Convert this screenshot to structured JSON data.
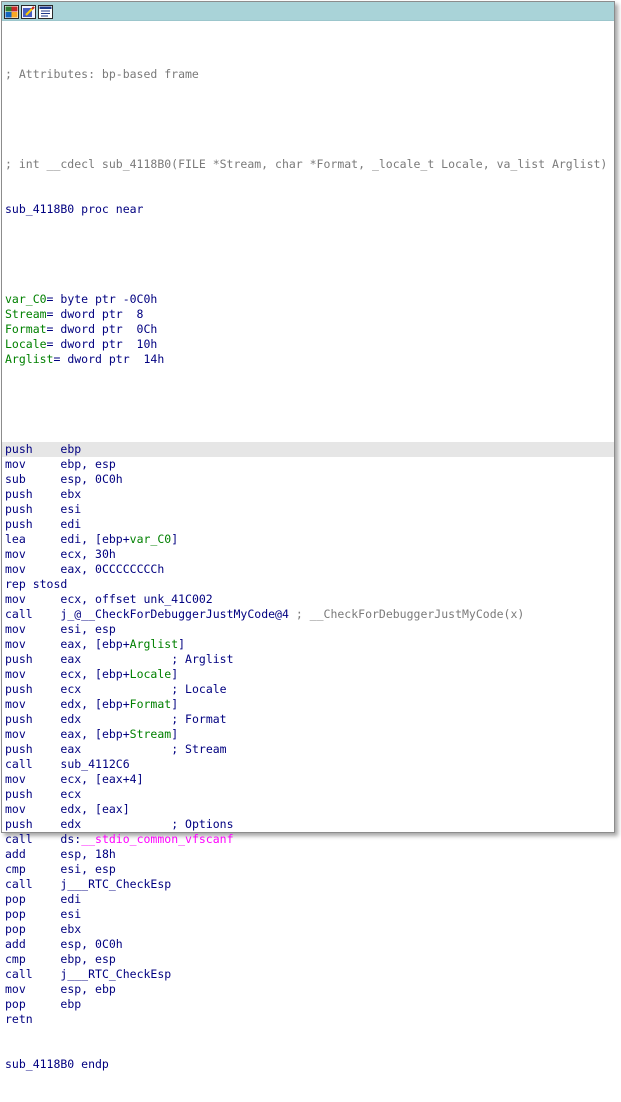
{
  "toolbar": {
    "icons": [
      "graph-view-icon",
      "edit-icon",
      "text-view-icon"
    ]
  },
  "colors": {
    "toolbar_bg": "#a9d3d8",
    "code_blue": "#000080",
    "comment_gray": "#7a7a7a",
    "var_green": "#008000",
    "import_magenta": "#ff00ff",
    "highlight": "#e6e6e6"
  },
  "listing": {
    "attributes_comment": "; Attributes: bp-based frame",
    "signature_comment": "; int __cdecl sub_4118B0(FILE *Stream, char *Format, _locale_t Locale, va_list Arglist)",
    "proc_start": "sub_4118B0 proc near",
    "vars": [
      {
        "name": "var_C0",
        "def": "= byte ptr -0C0h"
      },
      {
        "name": "Stream",
        "def": "= dword ptr  8"
      },
      {
        "name": "Format",
        "def": "= dword ptr  0Ch"
      },
      {
        "name": "Locale",
        "def": "= dword ptr  10h"
      },
      {
        "name": "Arglist",
        "def": "= dword ptr  14h"
      }
    ],
    "instructions": [
      {
        "mnem": "push",
        "ops": "ebp"
      },
      {
        "mnem": "mov",
        "ops": "ebp, esp"
      },
      {
        "mnem": "sub",
        "ops": "esp, 0C0h"
      },
      {
        "mnem": "push",
        "ops": "ebx"
      },
      {
        "mnem": "push",
        "ops": "esi"
      },
      {
        "mnem": "push",
        "ops": "edi"
      },
      {
        "mnem": "lea",
        "ops_pre": "edi, [ebp+",
        "ops_var": "var_C0",
        "ops_post": "]"
      },
      {
        "mnem": "mov",
        "ops": "ecx, 30h"
      },
      {
        "mnem": "mov",
        "ops": "eax, 0CCCCCCCCh"
      },
      {
        "mnem": "rep stosd",
        "ops": ""
      },
      {
        "mnem": "mov",
        "ops": "ecx, offset unk_41C002"
      },
      {
        "mnem": "call",
        "ops": "j_@__CheckForDebuggerJustMyCode@4",
        "cmt": "; __CheckForDebuggerJustMyCode(x)"
      },
      {
        "mnem": "mov",
        "ops": "esi, esp"
      },
      {
        "mnem": "mov",
        "ops_pre": "eax, [ebp+",
        "ops_var": "Arglist",
        "ops_post": "]"
      },
      {
        "mnem": "push",
        "ops": "eax",
        "cmt": "; Arglist"
      },
      {
        "mnem": "mov",
        "ops_pre": "ecx, [ebp+",
        "ops_var": "Locale",
        "ops_post": "]"
      },
      {
        "mnem": "push",
        "ops": "ecx",
        "cmt": "; Locale"
      },
      {
        "mnem": "mov",
        "ops_pre": "edx, [ebp+",
        "ops_var": "Format",
        "ops_post": "]"
      },
      {
        "mnem": "push",
        "ops": "edx",
        "cmt": "; Format"
      },
      {
        "mnem": "mov",
        "ops_pre": "eax, [ebp+",
        "ops_var": "Stream",
        "ops_post": "]"
      },
      {
        "mnem": "push",
        "ops": "eax",
        "cmt": "; Stream"
      },
      {
        "mnem": "call",
        "ops": "sub_4112C6"
      },
      {
        "mnem": "mov",
        "ops": "ecx, [eax+4]"
      },
      {
        "mnem": "push",
        "ops": "ecx"
      },
      {
        "mnem": "mov",
        "ops": "edx, [eax]"
      },
      {
        "mnem": "push",
        "ops": "edx",
        "cmt": "; Options"
      },
      {
        "mnem": "call",
        "ops_pre": "ds:",
        "ops_import": "__stdio_common_vfscanf"
      },
      {
        "mnem": "add",
        "ops": "esp, 18h"
      },
      {
        "mnem": "cmp",
        "ops": "esi, esp"
      },
      {
        "mnem": "call",
        "ops": "j___RTC_CheckEsp"
      },
      {
        "mnem": "pop",
        "ops": "edi"
      },
      {
        "mnem": "pop",
        "ops": "esi"
      },
      {
        "mnem": "pop",
        "ops": "ebx"
      },
      {
        "mnem": "add",
        "ops": "esp, 0C0h"
      },
      {
        "mnem": "cmp",
        "ops": "ebp, esp"
      },
      {
        "mnem": "call",
        "ops": "j___RTC_CheckEsp"
      },
      {
        "mnem": "mov",
        "ops": "esp, ebp"
      },
      {
        "mnem": "pop",
        "ops": "ebp"
      },
      {
        "mnem": "retn",
        "ops": ""
      }
    ],
    "proc_end": "sub_4118B0 endp"
  }
}
